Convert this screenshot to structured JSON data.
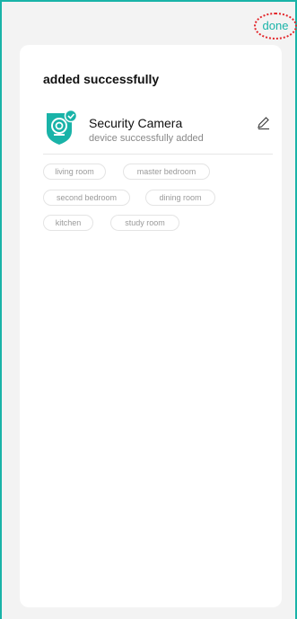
{
  "header": {
    "done_label": "done"
  },
  "card": {
    "title": "added successfully",
    "device": {
      "name": "Security Camera",
      "status": "device successfully added",
      "icon": "security-camera-icon"
    },
    "rooms": [
      "living room",
      "master bedroom",
      "second bedroom",
      "dining room",
      "kitchen",
      "study room"
    ]
  },
  "colors": {
    "accent": "#19b3a8",
    "annotation": "#e3262b"
  }
}
